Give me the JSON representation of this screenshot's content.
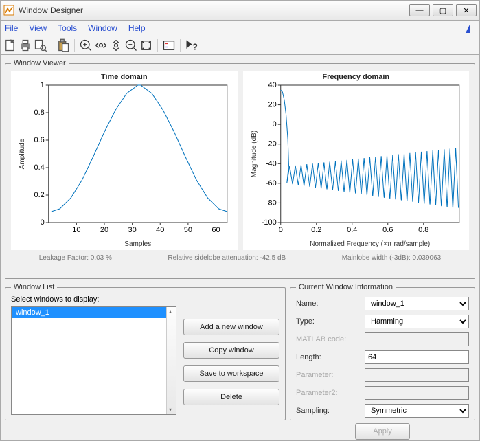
{
  "titlebar": {
    "title": "Window Designer"
  },
  "menu": {
    "file": "File",
    "view": "View",
    "tools": "Tools",
    "window": "Window",
    "help": "Help"
  },
  "viewer": {
    "legend": "Window Viewer",
    "status": {
      "leakage": "Leakage Factor: 0.03 %",
      "sidelobe": "Relative sidelobe attenuation: -42.5 dB",
      "mainlobe": "Mainlobe width (-3dB): 0.039063"
    }
  },
  "chart_data": [
    {
      "type": "line",
      "title": "Time domain",
      "xlabel": "Samples",
      "ylabel": "Amplitude",
      "xlim": [
        0,
        64
      ],
      "ylim": [
        0,
        1
      ],
      "xticks": [
        10,
        20,
        30,
        40,
        50,
        60
      ],
      "yticks": [
        0,
        0.2,
        0.4,
        0.6,
        0.8,
        1
      ],
      "x": [
        1,
        4,
        8,
        12,
        16,
        20,
        24,
        28,
        32,
        33,
        37,
        41,
        45,
        49,
        53,
        57,
        61,
        64
      ],
      "y": [
        0.08,
        0.1,
        0.18,
        0.31,
        0.48,
        0.66,
        0.82,
        0.94,
        1.0,
        1.0,
        0.94,
        0.82,
        0.66,
        0.48,
        0.31,
        0.18,
        0.1,
        0.08
      ]
    },
    {
      "type": "line",
      "title": "Frequency domain",
      "xlabel": "Normalized Frequency  (×π rad/sample)",
      "ylabel": "Magnitude (dB)",
      "xlim": [
        0,
        1
      ],
      "ylim": [
        -100,
        40
      ],
      "xticks": [
        0,
        0.2,
        0.4,
        0.6,
        0.8
      ],
      "yticks": [
        -100,
        -80,
        -60,
        -40,
        -20,
        0,
        20,
        40
      ],
      "mainlobe": {
        "x": [
          0,
          0.01,
          0.02,
          0.03,
          0.04,
          0.045
        ],
        "y": [
          35,
          33,
          25,
          10,
          -15,
          -42
        ]
      },
      "lobes": {
        "count": 30,
        "start_x": 0.05,
        "end_x": 0.98,
        "peak_start": -42.5,
        "peak_end": -24,
        "trough_start": -60,
        "trough_end": -85
      }
    }
  ],
  "windowlist": {
    "legend": "Window List",
    "prompt": "Select windows to display:",
    "items": [
      "window_1"
    ],
    "selected": 0,
    "buttons": {
      "add": "Add a new window",
      "copy": "Copy window",
      "save": "Save to workspace",
      "delete": "Delete"
    }
  },
  "info": {
    "legend": "Current Window Information",
    "labels": {
      "name": "Name:",
      "type": "Type:",
      "matlab": "MATLAB code:",
      "length": "Length:",
      "param": "Parameter:",
      "param2": "Parameter2:",
      "sampling": "Sampling:"
    },
    "values": {
      "name": "window_1",
      "type": "Hamming",
      "length": "64",
      "sampling": "Symmetric"
    },
    "apply": "Apply"
  }
}
